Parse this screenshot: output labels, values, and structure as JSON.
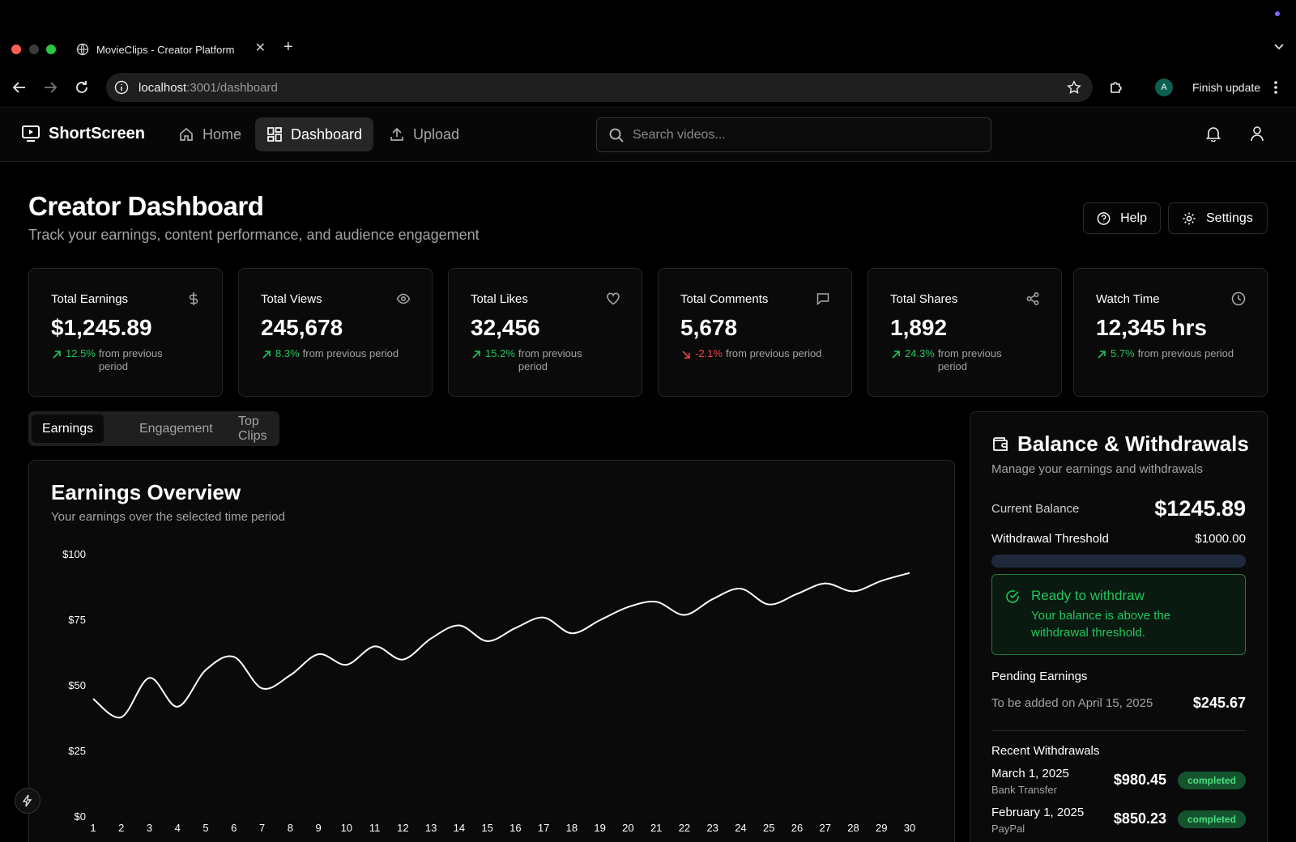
{
  "browser": {
    "tab_title": "MovieClips - Creator Platform",
    "url_host": "localhost",
    "url_path": ":3001/dashboard",
    "profile_initial": "A",
    "finish_update": "Finish update"
  },
  "header": {
    "brand": "ShortScreen",
    "nav": {
      "home": "Home",
      "dashboard": "Dashboard",
      "upload": "Upload"
    },
    "search_placeholder": "Search videos..."
  },
  "page": {
    "title": "Creator Dashboard",
    "subtitle": "Track your earnings, content performance, and audience engagement",
    "help": "Help",
    "settings": "Settings"
  },
  "stats": [
    {
      "label": "Total Earnings",
      "value": "$1,245.89",
      "change": "12.5%",
      "direction": "up",
      "note": "from previous period",
      "icon": "dollar-icon"
    },
    {
      "label": "Total Views",
      "value": "245,678",
      "change": "8.3%",
      "direction": "up",
      "note": "from previous period",
      "icon": "eye-icon"
    },
    {
      "label": "Total Likes",
      "value": "32,456",
      "change": "15.2%",
      "direction": "up",
      "note": "from previous period",
      "icon": "heart-icon"
    },
    {
      "label": "Total Comments",
      "value": "5,678",
      "change": "-2.1%",
      "direction": "down",
      "note": "from previous period",
      "icon": "comment-icon"
    },
    {
      "label": "Total Shares",
      "value": "1,892",
      "change": "24.3%",
      "direction": "up",
      "note": "from previous period",
      "icon": "share-icon"
    },
    {
      "label": "Watch Time",
      "value": "12,345 hrs",
      "change": "5.7%",
      "direction": "up",
      "note": "from previous period",
      "icon": "clock-icon"
    }
  ],
  "tabs": {
    "earnings": "Earnings",
    "engagement": "Engagement",
    "top_clips": "Top Clips"
  },
  "chart": {
    "title": "Earnings Overview",
    "subtitle": "Your earnings over the selected time period"
  },
  "chart_data": {
    "type": "line",
    "x": [
      1,
      2,
      3,
      4,
      5,
      6,
      7,
      8,
      9,
      10,
      11,
      12,
      13,
      14,
      15,
      16,
      17,
      18,
      19,
      20,
      21,
      22,
      23,
      24,
      25,
      26,
      27,
      28,
      29,
      30
    ],
    "values": [
      45,
      38,
      53,
      42,
      56,
      61,
      49,
      54,
      62,
      58,
      65,
      60,
      68,
      73,
      67,
      72,
      76,
      70,
      75,
      80,
      82,
      77,
      83,
      87,
      81,
      85,
      89,
      86,
      90,
      93
    ],
    "ylim": [
      0,
      100
    ],
    "y_ticks": [
      "$0",
      "$25",
      "$50",
      "$75",
      "$100"
    ],
    "y_tick_values": [
      0,
      25,
      50,
      75,
      100
    ],
    "line_color": "#ffffff",
    "grid": false
  },
  "balance": {
    "title": "Balance & Withdrawals",
    "subtitle": "Manage your earnings and withdrawals",
    "current_label": "Current Balance",
    "current_value": "$1245.89",
    "threshold_label": "Withdrawal Threshold",
    "threshold_value": "$1000.00",
    "progress": 1.0,
    "ready_title": "Ready to withdraw",
    "ready_text": "Your balance is above the withdrawal threshold.",
    "pending_title": "Pending Earnings",
    "pending_label": "To be added on April 15, 2025",
    "pending_value": "$245.67",
    "recent_title": "Recent Withdrawals",
    "withdrawals": [
      {
        "date": "March 1, 2025",
        "method": "Bank Transfer",
        "amount": "$980.45",
        "status": "completed"
      },
      {
        "date": "February 1, 2025",
        "method": "PayPal",
        "amount": "$850.23",
        "status": "completed"
      }
    ]
  },
  "colors": {
    "accent_green": "#22c55e",
    "negative_red": "#ef4444",
    "progress_track": "#1e293b"
  }
}
